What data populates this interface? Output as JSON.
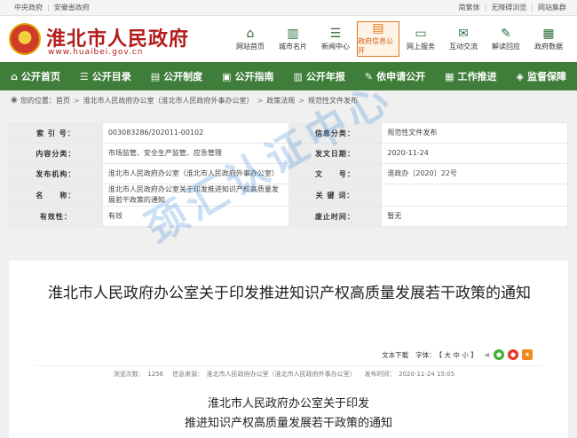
{
  "topbar": {
    "left": [
      "中央政府",
      "安徽省政府"
    ],
    "right": [
      "简繁体",
      "无障碍浏览",
      "网站集群"
    ]
  },
  "header": {
    "title": "淮北市人民政府",
    "url": "www.huaibei.gov.cn",
    "quick_links": [
      {
        "label": "网站首页",
        "icon": "home-icon"
      },
      {
        "label": "城市名片",
        "icon": "city-icon"
      },
      {
        "label": "新闻中心",
        "icon": "news-icon"
      },
      {
        "label": "政府信息公开",
        "icon": "info-icon",
        "active": true
      },
      {
        "label": "网上服务",
        "icon": "service-icon"
      },
      {
        "label": "互动交流",
        "icon": "chat-icon"
      },
      {
        "label": "解读回应",
        "icon": "reply-icon"
      },
      {
        "label": "政府数据",
        "icon": "data-icon"
      }
    ]
  },
  "nav": [
    "公开首页",
    "公开目录",
    "公开制度",
    "公开指南",
    "公开年报",
    "依申请公开",
    "工作推进",
    "监督保障"
  ],
  "breadcrumb": {
    "prefix": "您的位置：",
    "items": [
      "首页",
      "淮北市人民政府办公室（淮北市人民政府外事办公室）",
      "政策法规",
      "规范性文件发布"
    ]
  },
  "meta": {
    "rows": [
      {
        "k1": "索 引 号：",
        "v1": "003083286/202011-00102",
        "k2": "信息分类：",
        "v2": "规范性文件发布"
      },
      {
        "k1": "内容分类：",
        "v1": "市场监管、安全生产监管、应急管理",
        "k2": "发文日期：",
        "v2": "2020-11-24"
      },
      {
        "k1": "发布机构：",
        "v1": "淮北市人民政府办公室（淮北市人民政府外事办公室）",
        "k2": "文　　号：",
        "v2": "淮政办〔2020〕22号"
      },
      {
        "k1": "名　　称：",
        "v1": "淮北市人民政府办公室关于印发推进知识产权高质量发展若干政策的通知",
        "k2": "关 键 词：",
        "v2": ""
      },
      {
        "k1": "有效性：",
        "v1": "有效",
        "k2": "废止时间：",
        "v2": "暂无"
      }
    ]
  },
  "article": {
    "title": "淮北市人民政府办公室关于印发推进知识产权高质量发展若干政策的通知",
    "tools": {
      "download": "文本下载",
      "font_label": "字体：",
      "font_sizes": "【 大 中 小 】"
    },
    "stats": {
      "views": "浏览次数：　1256",
      "source": "信息来源：　淮北市人民政府办公室（淮北市人民政府外事办公室）",
      "time": "发布时间：　2020-11-24 15:05"
    },
    "sub_title_1": "淮北市人民政府办公室关于印发",
    "sub_title_2": "推进知识产权高质量发展若干政策的通知"
  },
  "watermark": "颈汇认证中心",
  "colors": {
    "nav_green": "#3f7e3a",
    "title_red": "#b31b1b",
    "watermark_blue": "#468cdc"
  }
}
